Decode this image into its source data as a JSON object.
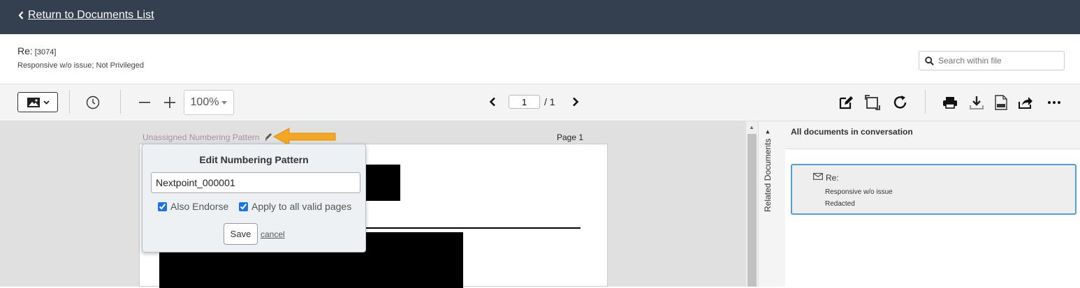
{
  "nav": {
    "back_label": "Return to Documents List"
  },
  "document": {
    "title_prefix": "Re:",
    "title_id": "[3074]",
    "subtitle": "Responsive w/o issue; Not Privileged"
  },
  "search": {
    "placeholder": "Search within file"
  },
  "toolbar": {
    "zoom_value": "100%",
    "page_current": "1",
    "page_total": "/ 1"
  },
  "viewer": {
    "numbering_pattern_label": "Unassigned Numbering Pattern",
    "page_label": "Page 1"
  },
  "popup": {
    "title": "Edit Numbering Pattern",
    "pattern_value": "Nextpoint_000001",
    "also_endorse_label": "Also Endorse",
    "also_endorse_checked": true,
    "apply_all_label": "Apply to all valid pages",
    "apply_all_checked": true,
    "save_label": "Save",
    "cancel_label": "cancel"
  },
  "related_tab": {
    "label": "Related Documents"
  },
  "sidebar": {
    "header": "All documents in conversation",
    "items": [
      {
        "title": "Re:",
        "line2": "Responsive w/o issue",
        "line3": "Redacted"
      }
    ]
  },
  "colors": {
    "topbar": "#343f4f",
    "accent": "#4aa3df",
    "arrow": "#f5a623"
  }
}
